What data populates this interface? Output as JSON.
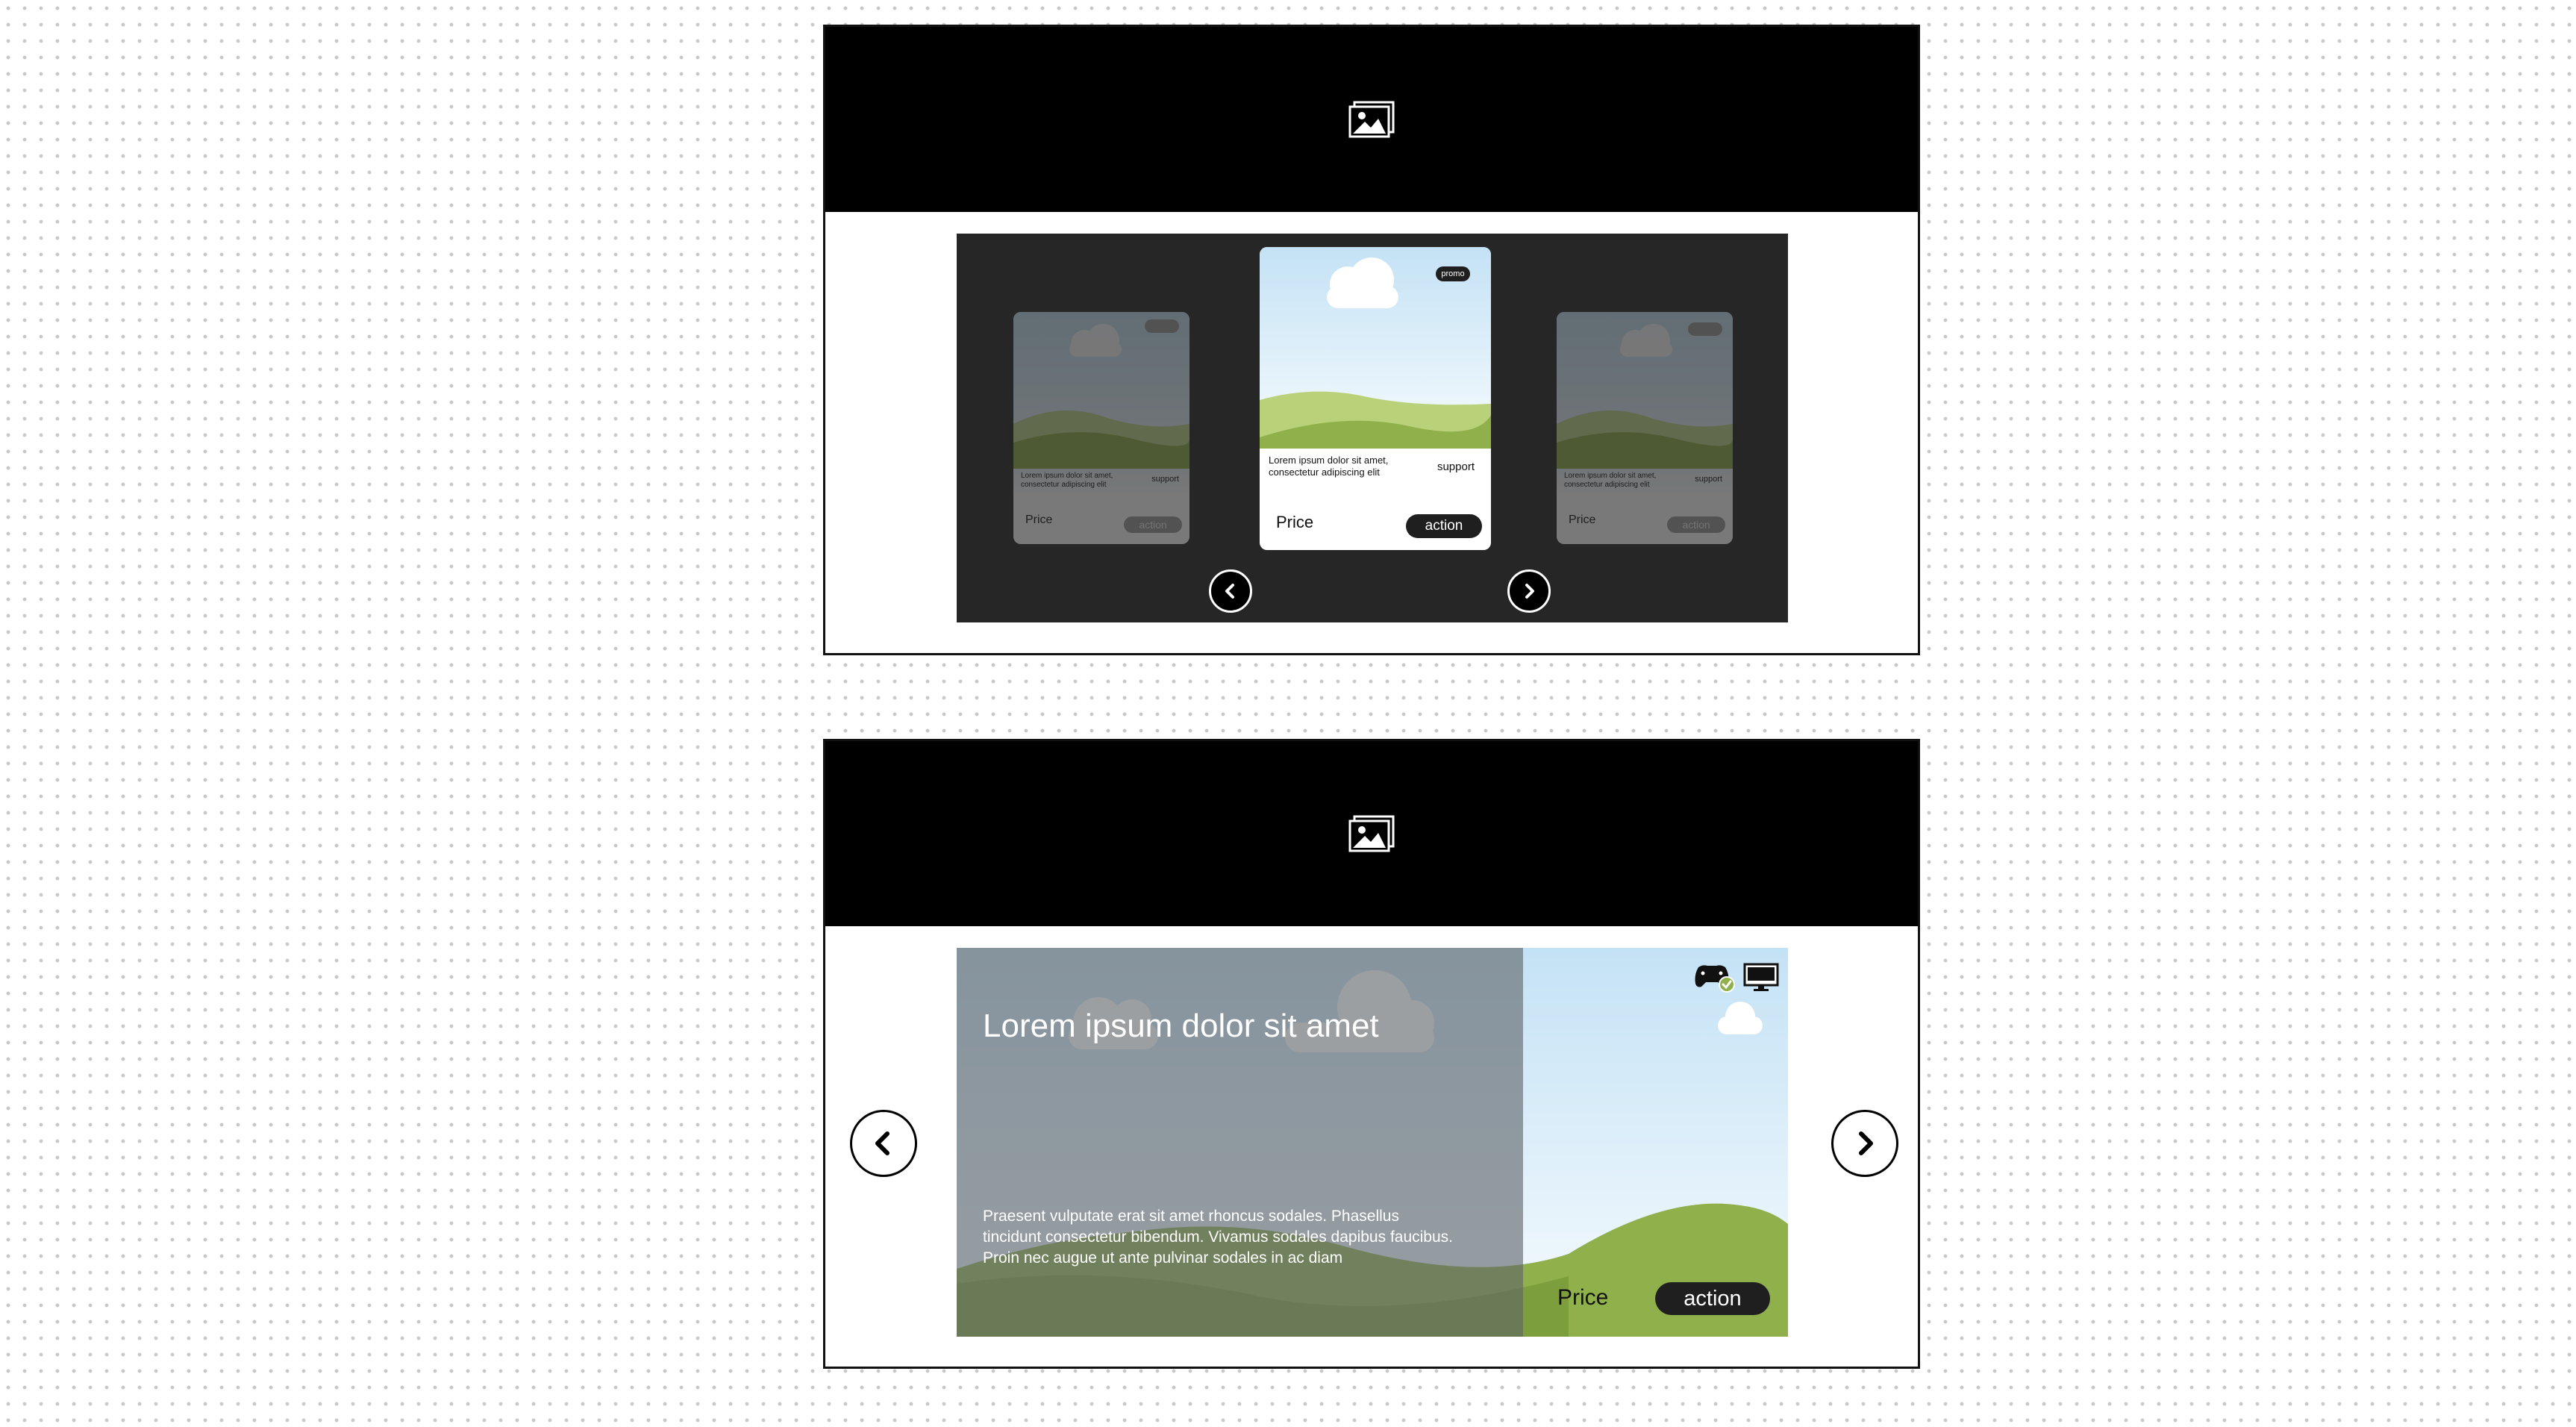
{
  "carousel_compact": {
    "hero_icon": "image-icon",
    "cards": [
      {
        "position": "previous",
        "badge": "",
        "description": "Lorem ipsum dolor sit amet, consectetur adipiscing elit",
        "support": "support",
        "price": "Price",
        "action": "action"
      },
      {
        "position": "current",
        "badge": "promo",
        "description": "Lorem ipsum dolor sit amet, consectetur adipiscing elit",
        "support": "support",
        "price": "Price",
        "action": "action"
      },
      {
        "position": "next",
        "badge": "",
        "description": "Lorem ipsum dolor sit amet, consectetur adipiscing elit",
        "support": "support",
        "price": "Price",
        "action": "action"
      }
    ],
    "prev_icon": "chevron-left-icon",
    "next_icon": "chevron-right-icon"
  },
  "carousel_featured": {
    "hero_icon": "image-icon",
    "title": "Lorem ipsum dolor sit amet",
    "description": "Praesent vulputate erat sit amet rhoncus sodales. Phasellus tincidunt consectetur bibendum. Vivamus sodales dapibus faucibus. Proin nec augue ut ante pulvinar sodales in ac diam",
    "price": "Price",
    "action": "action",
    "platform_icons": [
      "gamepad-verified-icon",
      "desktop-monitor-icon"
    ],
    "prev_icon": "chevron-left-icon",
    "next_icon": "chevron-right-icon"
  },
  "colors": {
    "accent": "#1f1f1f",
    "stage_bg": "#262626",
    "hill_green": "#8fb04a",
    "sky": "#cfe7f6"
  }
}
